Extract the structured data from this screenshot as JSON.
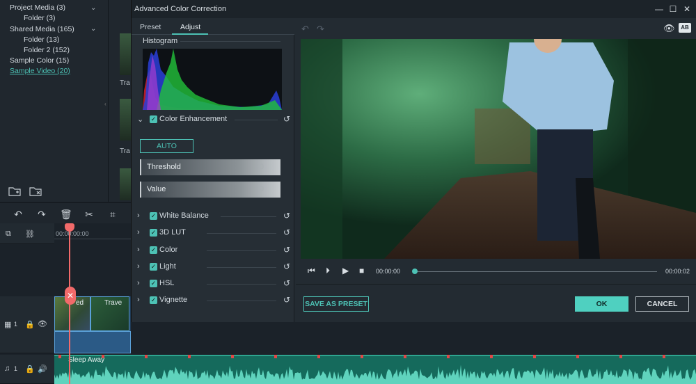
{
  "library": {
    "items": [
      {
        "label": "Project Media (3)",
        "level": 0,
        "expandable": true
      },
      {
        "label": "Folder (3)",
        "level": 1
      },
      {
        "label": "Shared Media (165)",
        "level": 0,
        "expandable": true
      },
      {
        "label": "Folder (13)",
        "level": 1
      },
      {
        "label": "Folder 2 (152)",
        "level": 1
      },
      {
        "label": "Sample Color (15)",
        "level": 0
      },
      {
        "label": "Sample Video (20)",
        "level": 0,
        "active": true
      }
    ],
    "thumb_labels": [
      "Tra",
      "Tra"
    ]
  },
  "timeline": {
    "ruler_time": "00:00:00:00",
    "video_track_index": "1",
    "audio_track_index": "1",
    "clips": [
      {
        "title": "Tra",
        "title_suffix": "ed"
      },
      {
        "title": "Trave"
      }
    ],
    "audio_title": "Sleep Away"
  },
  "dialog": {
    "title": "Advanced Color Correction",
    "tabs": [
      {
        "label": "Preset",
        "active": false
      },
      {
        "label": "Adjust",
        "active": true
      }
    ],
    "histogram_label": "Histogram",
    "color_enhancement": {
      "label": "Color Enhancement",
      "checked": true,
      "expanded": true,
      "auto_label": "AUTO",
      "sliders": [
        {
          "label": "Threshold",
          "value": "0"
        },
        {
          "label": "Value",
          "value": "0"
        }
      ]
    },
    "sections": [
      {
        "label": "White Balance",
        "checked": true
      },
      {
        "label": "3D LUT",
        "checked": true
      },
      {
        "label": "Color",
        "checked": true
      },
      {
        "label": "Light",
        "checked": true
      },
      {
        "label": "HSL",
        "checked": true
      },
      {
        "label": "Vignette",
        "checked": true
      }
    ],
    "player": {
      "current_time": "00:00:00",
      "end_time": "00:00:02",
      "progress": 0.0
    },
    "buttons": {
      "save_preset": "SAVE AS PRESET",
      "ok": "OK",
      "cancel": "CANCEL"
    },
    "ab_label": "AB",
    "accent_color": "#4dc2b5"
  }
}
